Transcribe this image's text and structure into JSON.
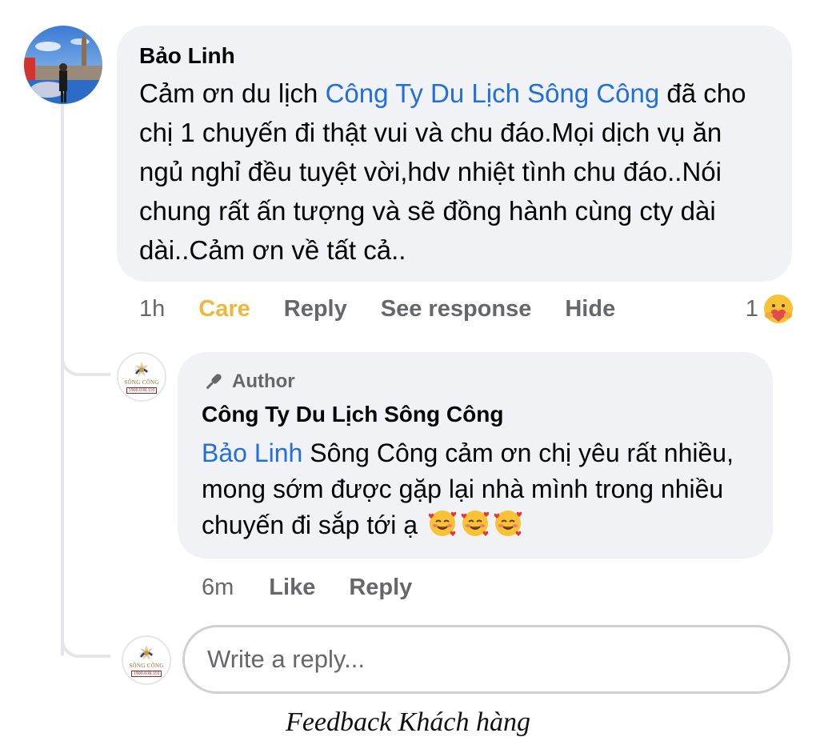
{
  "comment": {
    "author": "Bảo Linh",
    "text_before_mention": "Cảm ơn du lịch ",
    "mention": "Công Ty Du Lịch Sông Công",
    "text_after_mention": " đã cho chị 1 chuyến đi thật vui và chu đáo.Mọi dịch vụ ăn ngủ nghỉ đều tuyệt vời,hdv nhiệt tình chu đáo..Nói chung rất ấn tượng và sẽ đồng hành cùng cty dài dài..Cảm ơn về tất cả..",
    "actions": {
      "time": "1h",
      "reaction_label": "Care",
      "reply": "Reply",
      "see_response": "See response",
      "hide": "Hide"
    },
    "reaction": {
      "count": "1",
      "icon": "care-emoji",
      "color": "#f0b63c"
    }
  },
  "reply": {
    "badge": "Author",
    "badge_icon": "microphone-icon",
    "author": "Công Ty Du Lịch Sông Công",
    "mention": "Bảo Linh",
    "text": " Sông Công cảm ơn chị yêu rất nhiều, mong sớm được gặp lại nhà mình trong nhiều chuyến đi sắp tới ạ",
    "emojis": [
      "smiling-face-with-hearts",
      "smiling-face-with-hearts",
      "smiling-face-with-hearts"
    ],
    "actions": {
      "time": "6m",
      "like": "Like",
      "reply": "Reply"
    }
  },
  "brand_avatar": {
    "name": "SÔNG CÔNG",
    "phone": "1900.038.110"
  },
  "composer": {
    "placeholder": "Write a reply..."
  },
  "caption": "Feedback Khách hàng",
  "colors": {
    "mention": "#216fdb",
    "bubble": "#f0f2f5",
    "muted": "#65676b"
  }
}
